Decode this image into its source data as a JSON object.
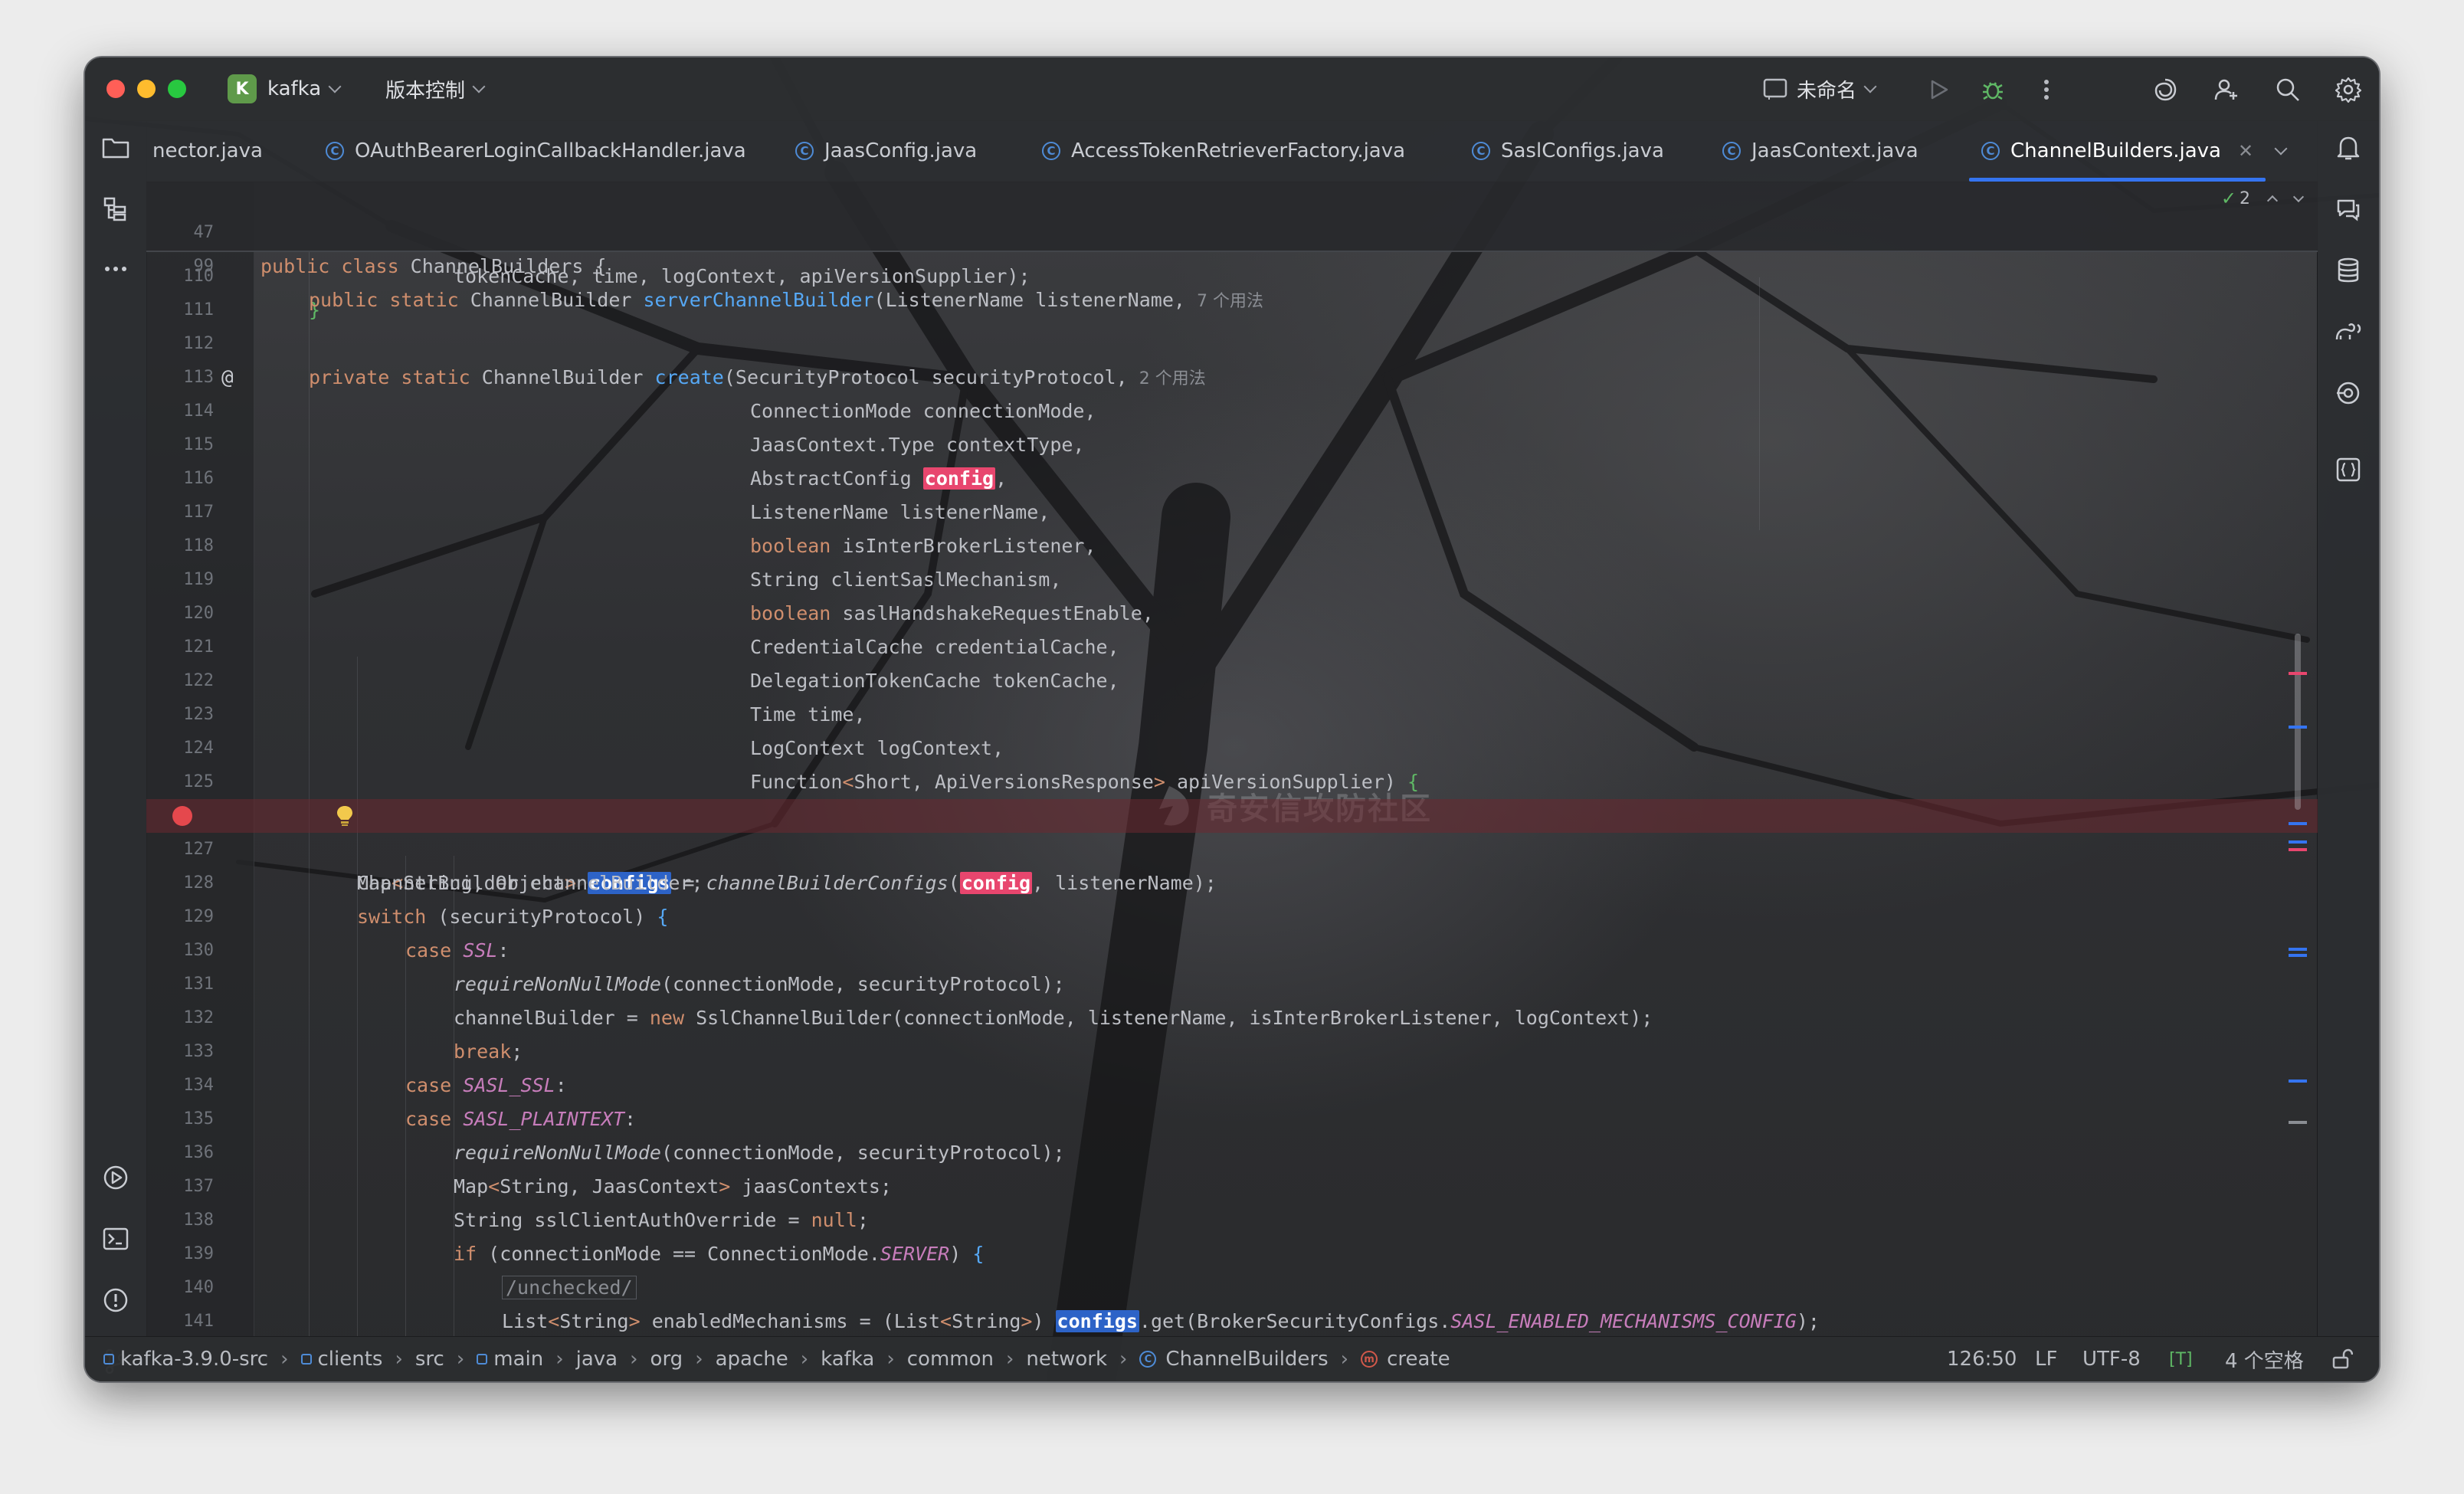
{
  "titlebar": {
    "project_initial": "K",
    "project_name": "kafka",
    "vcs_label": "版本控制",
    "run_config": "未命名"
  },
  "tabs": [
    {
      "label": "nector.java"
    },
    {
      "label": "OAuthBearerLoginCallbackHandler.java"
    },
    {
      "label": "JaasConfig.java"
    },
    {
      "label": "AccessTokenRetrieverFactory.java"
    },
    {
      "label": "SaslConfigs.java"
    },
    {
      "label": "JaasContext.java"
    },
    {
      "label": "ChannelBuilders.java",
      "active": true
    }
  ],
  "editor": {
    "problems_count": "2",
    "sticky": [
      {
        "num": "47",
        "code": "public class ChannelBuilders {"
      },
      {
        "num": "99",
        "code": "public static ChannelBuilder serverChannelBuilder(ListenerName listenerName,",
        "hint": "7 个用法"
      }
    ],
    "line_numbers": [
      "110",
      "111",
      "112",
      "113",
      "114",
      "115",
      "116",
      "117",
      "118",
      "119",
      "120",
      "121",
      "122",
      "123",
      "124",
      "125",
      "",
      "127",
      "128",
      "129",
      "130",
      "131",
      "132",
      "133",
      "134",
      "135",
      "136",
      "137",
      "138",
      "139",
      "140",
      "141"
    ],
    "usage_hint_113": "2 个用法",
    "watermark": "奇安信攻防社区"
  },
  "statusbar": {
    "crumbs": [
      "kafka-3.9.0-src",
      "clients",
      "src",
      "main",
      "java",
      "org",
      "apache",
      "kafka",
      "common",
      "network",
      "ChannelBuilders",
      "create"
    ],
    "position": "126:50",
    "line_sep": "LF",
    "encoding": "UTF-8",
    "indent": "4 个空格"
  }
}
